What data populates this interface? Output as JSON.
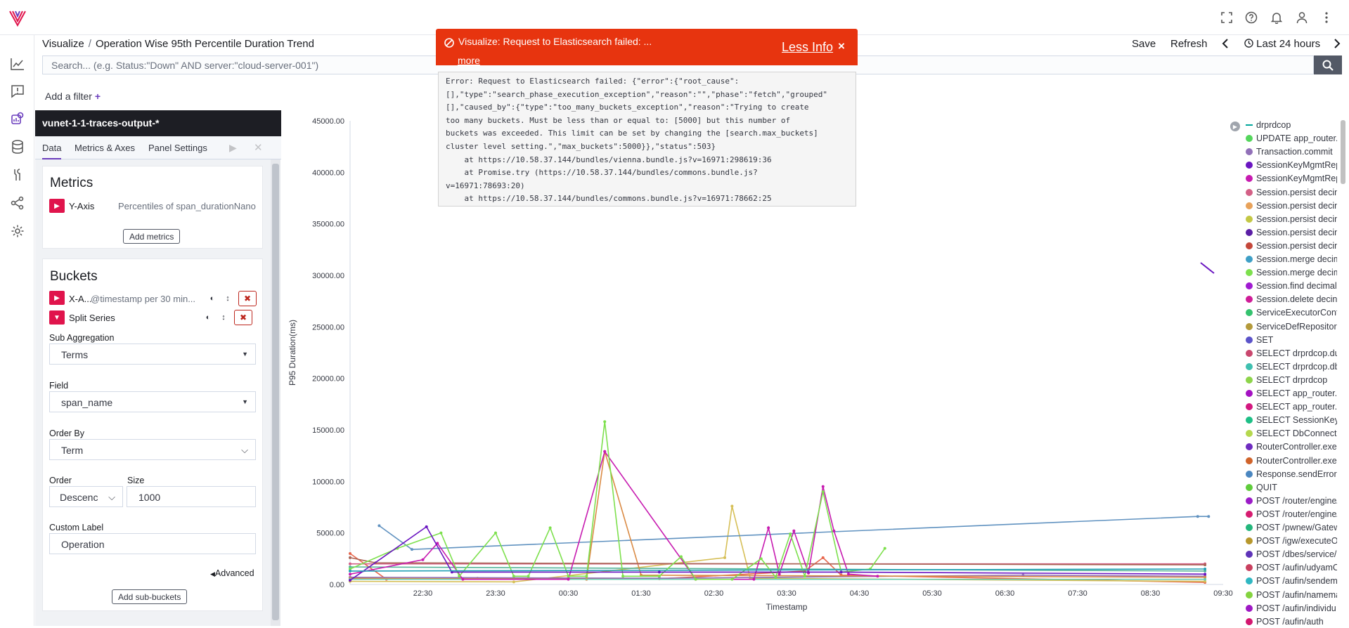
{
  "breadcrumb": {
    "app": "Visualize",
    "separator": "/",
    "title": "Operation Wise 95th Percentile Duration Trend"
  },
  "header": {
    "save": "Save",
    "refresh": "Refresh",
    "time_range": "Last 24 hours"
  },
  "search": {
    "placeholder": "Search... (e.g. Status:\"Down\" AND server:\"cloud-server-001\")"
  },
  "filter": {
    "label": "Add a filter",
    "plus": "+"
  },
  "panel": {
    "index_title": "vunet-1-1-traces-output-*",
    "tabs": [
      "Data",
      "Metrics & Axes",
      "Panel Settings"
    ],
    "metrics": {
      "heading": "Metrics",
      "item_label": "Y-Axis",
      "item_value": "Percentiles of span_durationNano",
      "add_button": "Add metrics"
    },
    "buckets": {
      "heading": "Buckets",
      "xaxis_label": "X-A...",
      "xaxis_value": "@timestamp per 30 min...",
      "split_label": "Split Series",
      "sub_agg_label": "Sub Aggregation",
      "sub_agg_value": "Terms",
      "field_label": "Field",
      "field_value": "span_name",
      "orderby_label": "Order By",
      "orderby_value": "Term",
      "order_label": "Order",
      "order_value": "Descenc",
      "size_label": "Size",
      "size_value": "1000",
      "custom_label_label": "Custom Label",
      "custom_label_value": "Operation",
      "advanced": "Advanced",
      "add_sub": "Add sub-buckets"
    }
  },
  "toast": {
    "title": "Visualize: Request to Elasticsearch failed: ...",
    "more": "more",
    "less_info": "Less Info",
    "close": "×",
    "error_text": "Error: Request to Elasticsearch failed: {\"error\":{\"root_cause\":\n[],\"type\":\"search_phase_execution_exception\",\"reason\":\"\",\"phase\":\"fetch\",\"grouped\"\n[],\"caused_by\":{\"type\":\"too_many_buckets_exception\",\"reason\":\"Trying to create\ntoo many buckets. Must be less than or equal to: [5000] but this number of\nbuckets was exceeded. This limit can be set by changing the [search.max_buckets]\ncluster level setting.\",\"max_buckets\":5000}},\"status\":503}\n    at https://10.58.37.144/bundles/vienna.bundle.js?v=16971:298619:36\n    at Promise.try (https://10.58.37.144/bundles/commons.bundle.js?\nv=16971:78693:20)\n    at https://10.58.37.144/bundles/commons.bundle.js?v=16971:78662:25"
  },
  "chart_data": {
    "type": "line",
    "xlabel": "Timestamp",
    "ylabel": "P95 Duration(ms)",
    "yticks": [
      "45000.00",
      "40000.00",
      "35000.00",
      "30000.00",
      "25000.00",
      "20000.00",
      "15000.00",
      "10000.00",
      "5000.00",
      "0.00"
    ],
    "xticks": [
      "22:30",
      "23:30",
      "00:30",
      "01:30",
      "02:30",
      "03:30",
      "04:30",
      "05:30",
      "06:30",
      "07:30",
      "08:30",
      "09:30"
    ],
    "ylim": [
      0,
      45000
    ],
    "x_start": "21:30",
    "series": [
      {
        "color": "#e7664c",
        "values": [
          [
            21.5,
            3000
          ],
          [
            22.5,
            500
          ],
          [
            25,
            600
          ],
          [
            30,
            550
          ],
          [
            34,
            1300
          ],
          [
            34.5,
            2600
          ],
          [
            35,
            900
          ],
          [
            45,
            200
          ]
        ]
      },
      {
        "color": "#d6bf57",
        "values": [
          [
            21.5,
            300
          ],
          [
            26,
            250
          ],
          [
            31.8,
            2600
          ],
          [
            32,
            7600
          ],
          [
            32.5,
            600
          ],
          [
            45,
            300
          ]
        ]
      },
      {
        "color": "#9170b8",
        "values": [
          [
            21.5,
            700
          ],
          [
            30,
            600
          ],
          [
            40,
            900
          ],
          [
            45,
            800
          ]
        ]
      },
      {
        "color": "#54b399",
        "values": [
          [
            21.5,
            1700
          ],
          [
            45,
            1300
          ]
        ]
      },
      {
        "color": "#6092c0",
        "values": [
          [
            22.3,
            5700
          ],
          [
            23.2,
            3400
          ],
          [
            44.8,
            6600
          ],
          [
            45.1,
            6600
          ]
        ]
      },
      {
        "color": "#da8b45",
        "values": [
          [
            21.5,
            600
          ],
          [
            28,
            500
          ],
          [
            28.5,
            12900
          ],
          [
            29.5,
            900
          ],
          [
            45,
            700
          ]
        ]
      },
      {
        "color": "#d36086",
        "values": [
          [
            21.5,
            2000
          ],
          [
            45,
            2000
          ]
        ]
      },
      {
        "color": "#aa6556",
        "values": [
          [
            21.5,
            2600
          ],
          [
            22.2,
            2100
          ],
          [
            45,
            1900
          ]
        ]
      },
      {
        "color": "#6dccb1",
        "values": [
          [
            21.5,
            500
          ],
          [
            45,
            500
          ]
        ]
      },
      {
        "color": "#c71bb0",
        "values": [
          [
            21.5,
            1000
          ],
          [
            23.5,
            2400
          ],
          [
            23.9,
            4000
          ],
          [
            24.6,
            500
          ],
          [
            27.5,
            500
          ],
          [
            28.5,
            12900
          ],
          [
            31,
            500
          ],
          [
            32.6,
            500
          ],
          [
            33,
            5500
          ],
          [
            33.3,
            1000
          ],
          [
            33.7,
            5200
          ],
          [
            34.1,
            1100
          ],
          [
            34.5,
            9500
          ],
          [
            34.8,
            5200
          ],
          [
            35.2,
            1000
          ],
          [
            36,
            800
          ]
        ]
      },
      {
        "color": "#7de04d",
        "values": [
          [
            21.5,
            1500
          ],
          [
            22.8,
            3500
          ],
          [
            24.0,
            5000
          ],
          [
            24.5,
            800
          ],
          [
            25.5,
            5000
          ],
          [
            26,
            800
          ],
          [
            26.4,
            800
          ],
          [
            27.0,
            5500
          ],
          [
            27.5,
            800
          ],
          [
            28,
            800
          ],
          [
            28.5,
            15800
          ],
          [
            29.0,
            800
          ],
          [
            30,
            800
          ],
          [
            30.6,
            2700
          ],
          [
            31,
            500
          ],
          [
            32,
            500
          ],
          [
            32.8,
            2500
          ],
          [
            33.2,
            700
          ],
          [
            33.6,
            4900
          ],
          [
            34,
            800
          ],
          [
            34.5,
            9000
          ],
          [
            35.0,
            1200
          ],
          [
            35.8,
            1500
          ],
          [
            36.2,
            3500
          ]
        ]
      },
      {
        "color": "#6a15c1",
        "values": [
          [
            21.5,
            400
          ],
          [
            23.6,
            5600
          ],
          [
            24.3,
            1200
          ],
          [
            30,
            1200
          ],
          [
            35,
            1200
          ],
          [
            45,
            1000
          ]
        ]
      },
      {
        "color": "#21a0b5",
        "values": [
          [
            21.5,
            1300
          ],
          [
            45,
            1500
          ]
        ]
      }
    ]
  },
  "legend": [
    {
      "label": "drprdcop",
      "color": "#00a69b",
      "marker": "line"
    },
    {
      "label": "UPDATE app_router.a",
      "color": "#54d65c"
    },
    {
      "label": "Transaction.commit",
      "color": "#9170b8"
    },
    {
      "label": "SessionKeyMgmtRep",
      "color": "#6a15c1"
    },
    {
      "label": "SessionKeyMgmtRep",
      "color": "#c71bb0"
    },
    {
      "label": "Session.persist decin",
      "color": "#d36086"
    },
    {
      "label": "Session.persist decin",
      "color": "#e8a25a"
    },
    {
      "label": "Session.persist decin",
      "color": "#c3c744"
    },
    {
      "label": "Session.persist decin",
      "color": "#5a1ea5"
    },
    {
      "label": "Session.persist decin",
      "color": "#c4473a"
    },
    {
      "label": "Session.merge decim",
      "color": "#3e9fc6"
    },
    {
      "label": "Session.merge decim",
      "color": "#7de04d"
    },
    {
      "label": "Session.find decimal.",
      "color": "#a01ad1"
    },
    {
      "label": "Session.delete decin",
      "color": "#cf1c97"
    },
    {
      "label": "ServiceExecutorCont",
      "color": "#34c26e"
    },
    {
      "label": "ServiceDefRepositor",
      "color": "#b49a3b"
    },
    {
      "label": "SET",
      "color": "#5b53c9"
    },
    {
      "label": "SELECT drprdcop.du",
      "color": "#c9476e"
    },
    {
      "label": "SELECT drprdcop.db",
      "color": "#3fc0b0"
    },
    {
      "label": "SELECT drprdcop",
      "color": "#8dd44a"
    },
    {
      "label": "SELECT app_router.s",
      "color": "#a411c2"
    },
    {
      "label": "SELECT app_router.e",
      "color": "#d3177f"
    },
    {
      "label": "SELECT SessionKeyN",
      "color": "#1dbf86"
    },
    {
      "label": "SELECT DbConnectio",
      "color": "#b5d84e"
    },
    {
      "label": "RouterController.exe",
      "color": "#6e2bc0"
    },
    {
      "label": "RouterController.exe",
      "color": "#d0632a"
    },
    {
      "label": "Response.sendError",
      "color": "#4a86c0"
    },
    {
      "label": "QUIT",
      "color": "#5fcc3b"
    },
    {
      "label": "POST /router/engine/",
      "color": "#9b1bc7"
    },
    {
      "label": "POST /router/engine/",
      "color": "#d61c70"
    },
    {
      "label": "POST /pwnew/Gatew",
      "color": "#23b67c"
    },
    {
      "label": "POST /igw/executeO",
      "color": "#b7972c"
    },
    {
      "label": "POST /dbes/service/",
      "color": "#5e33b8"
    },
    {
      "label": "POST /aufin/udyamC",
      "color": "#c9405f"
    },
    {
      "label": "POST /aufin/sendem",
      "color": "#2fb7c2"
    },
    {
      "label": "POST /aufin/namema",
      "color": "#84d33f"
    },
    {
      "label": "POST /aufin/individu",
      "color": "#9e18c4"
    },
    {
      "label": "POST /aufin/auth",
      "color": "#d3166f"
    }
  ]
}
